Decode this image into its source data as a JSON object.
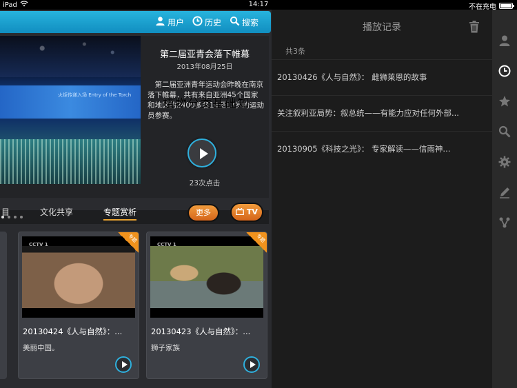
{
  "status_bar": {
    "device": "iPad",
    "time": "14:17",
    "battery_text": "不在充电",
    "battery_level": 0.8
  },
  "top_nav": {
    "user": "用户",
    "history": "历史",
    "search": "搜索"
  },
  "hero": {
    "title": "第二届亚青会落下帷幕",
    "date": "2013年08月25日",
    "description": "第二届亚洲青年运动会昨晚在南京落下帷幕，共有来自亚洲45个国家和地区的2400多名14至17岁的运动员参赛。",
    "overlay_text": "植物分类基础知",
    "screen_text": "火炬传递入场 Entry of the Torch",
    "clicks": "23次点击"
  },
  "tabs": [
    {
      "label": "目"
    },
    {
      "label": "文化共享"
    },
    {
      "label": "专题赏析"
    }
  ],
  "buttons": {
    "more": "更多",
    "tv": "TV"
  },
  "cards": [
    {
      "title": "20130424《人与自然》：...",
      "subtitle": "美丽中国。",
      "badge": "专题",
      "logo": "CCTV 1"
    },
    {
      "title": "20130423《人与自然》：...",
      "subtitle": "狮子家族",
      "badge": "专题",
      "logo": "CCTV 1"
    }
  ],
  "history_panel": {
    "title": "播放记录",
    "count": "共3条",
    "items": [
      "20130426《人与自然》： 雌狮莱恩的故事",
      "关注叙利亚局势：叙总统——有能力应对任何外部...",
      "20130905《科技之光》： 专家解读——信雨神..."
    ]
  },
  "colors": {
    "accent_blue": "#1aa0d0",
    "accent_orange": "#e8841f"
  }
}
